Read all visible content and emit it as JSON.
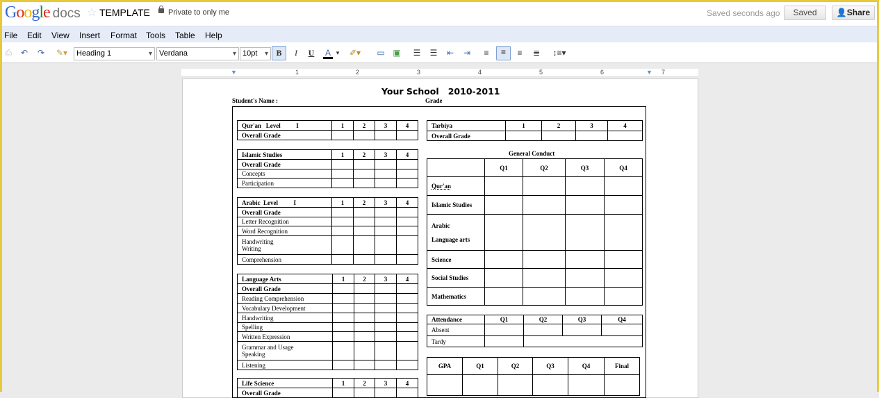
{
  "app": {
    "logo": "Google",
    "logo_suffix": "docs",
    "doc_title": "TEMPLATE",
    "privacy": "Private to only me",
    "save_status": "Saved seconds ago",
    "saved_button": "Saved",
    "share_button": "Share"
  },
  "menu": [
    "File",
    "Edit",
    "View",
    "Insert",
    "Format",
    "Tools",
    "Table",
    "Help"
  ],
  "toolbar": {
    "style": "Heading 1",
    "font": "Verdana",
    "size": "10pt",
    "bold": "B",
    "italic": "I",
    "underline": "U",
    "text_color": "A"
  },
  "ruler": [
    "1",
    "2",
    "3",
    "4",
    "5",
    "6",
    "7"
  ],
  "doc": {
    "heading": "Your School   2010-2011",
    "student_name": "Student's Name :",
    "grade": "Grade",
    "general_conduct_title": "General Conduct",
    "quran": {
      "header": [
        "Qur'an   Level          I",
        "1",
        "2",
        "3",
        "4"
      ],
      "rows": [
        "Overall Grade"
      ]
    },
    "islamic": {
      "header": [
        "Islamic Studies",
        "1",
        "2",
        "3",
        "4"
      ],
      "rows": [
        "Overall Grade",
        "Concepts",
        "Participation"
      ]
    },
    "arabic": {
      "header": [
        "Arabic  Level          I",
        "1",
        "2",
        "3",
        "4"
      ],
      "rows": [
        "Overall Grade",
        "Letter Recognition",
        "Word Recognition",
        "Handwriting\nWriting",
        "Comprehension"
      ]
    },
    "language_arts": {
      "header": [
        "Language Arts",
        "1",
        "2",
        "3",
        "4"
      ],
      "rows": [
        "Overall Grade",
        "Reading Comprehension",
        "Vocabulary Development",
        "Handwriting",
        "Spelling",
        "Written Expression",
        "Grammar and Usage\nSpeaking",
        "Listening"
      ]
    },
    "life_science": {
      "header": [
        "Life Science",
        "1",
        "2",
        "3",
        "4"
      ],
      "rows": [
        "Overall Grade"
      ]
    },
    "tarbiya": {
      "header": [
        "Tarbiya",
        "1",
        "2",
        "3",
        "4"
      ],
      "rows": [
        "Overall Grade"
      ]
    },
    "conduct": {
      "header": [
        "",
        "Q1",
        "Q2",
        "Q3",
        "Q4"
      ],
      "rows": [
        "Qur'an",
        "Islamic Studies",
        "Arabic\n\nLanguage arts",
        "Science",
        "Social Studies",
        "Mathematics"
      ]
    },
    "attendance": {
      "header": [
        "Attendance",
        "Q1",
        "Q2",
        "Q3",
        "Q4"
      ],
      "rows": [
        "Absent",
        "Tardy"
      ]
    },
    "gpa": {
      "header": [
        "GPA",
        "Q1",
        "Q2",
        "Q3",
        "Q4",
        "Final"
      ]
    }
  }
}
